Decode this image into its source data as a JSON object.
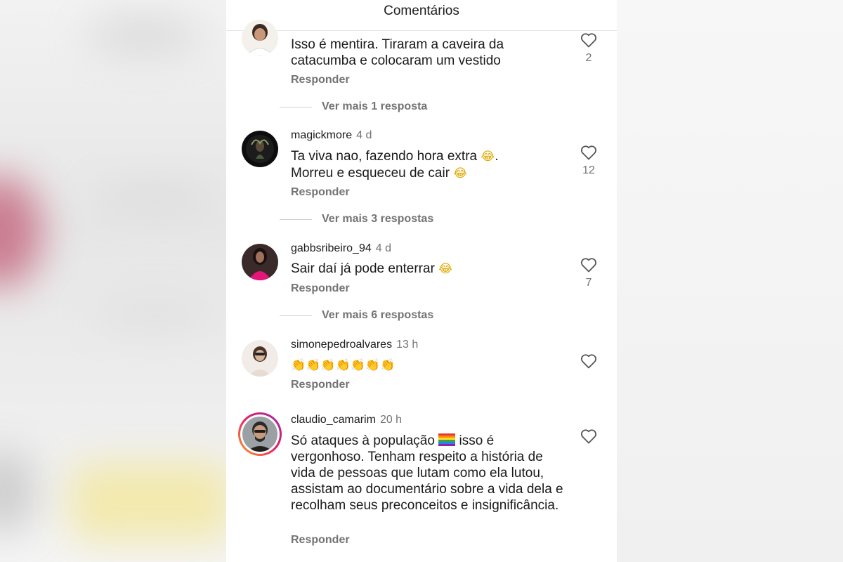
{
  "header": {
    "title": "Comentários"
  },
  "reply_label": "Responder",
  "comments": [
    {
      "username": "",
      "time": "",
      "text": "Isso é mentira. Tiraram a caveira da catacumba e colocaram um vestido",
      "likes": "2",
      "more_replies": "Ver mais 1 resposta"
    },
    {
      "username": "magickmore",
      "time": "4 d",
      "text_line1": "Ta viva nao, fazendo hora extra",
      "text_line1_emoji": "😂",
      "text_line1_end": ".",
      "text_line2": "Morreu e esqueceu de cair",
      "text_line2_emoji": "😂",
      "likes": "12",
      "more_replies": "Ver mais 3 respostas"
    },
    {
      "username": "gabbsribeiro_94",
      "time": "4 d",
      "text": "Sair daí já pode enterrar",
      "text_emoji": "😂",
      "likes": "7",
      "more_replies": "Ver mais 6 respostas"
    },
    {
      "username": "simonepedroalvares",
      "time": "13 h",
      "text_emoji": "👏👏👏👏👏👏👏"
    },
    {
      "username": "claudio_camarim",
      "time": "20 h",
      "text_a": "Só ataques à população",
      "flag": "rainbow-flag",
      "text_b": "isso é vergonhoso. Tenham respeito a história de vida de pessoas que lutam como ela lutou, assistam ao documentário sobre a vida dela e recolham seus preconceitos e insignificância."
    }
  ],
  "colors": {
    "secondary_text": "#737373",
    "primary_text": "#1a1a1a",
    "story_ring_start": "#f9a825",
    "story_ring_end": "#c2185b"
  }
}
